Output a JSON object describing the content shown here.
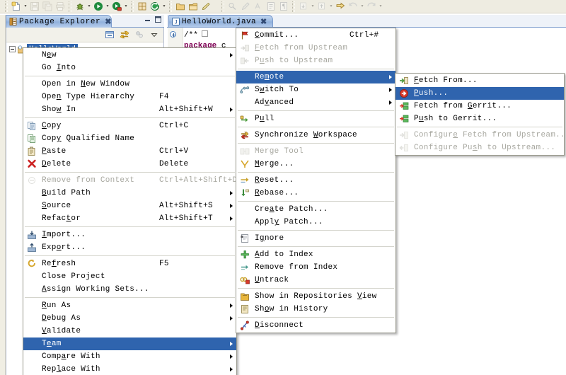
{
  "toolbar": {
    "groups": [
      {
        "name": "file-group",
        "buttons": [
          {
            "icon": "new-file-icon",
            "label": "New",
            "dropdown": true,
            "enabled": true
          },
          {
            "icon": "save-icon",
            "label": "Save",
            "dropdown": false,
            "enabled": false
          },
          {
            "icon": "save-all-icon",
            "label": "Save All",
            "dropdown": false,
            "enabled": false
          },
          {
            "icon": "print-icon",
            "label": "Print",
            "dropdown": false,
            "enabled": false
          }
        ]
      },
      {
        "name": "run-group",
        "buttons": [
          {
            "icon": "debug-icon",
            "label": "Debug",
            "dropdown": true,
            "enabled": true
          },
          {
            "icon": "run-icon",
            "label": "Run",
            "dropdown": true,
            "enabled": true
          },
          {
            "icon": "run-external-tools-icon",
            "label": "External Tools",
            "dropdown": true,
            "enabled": true
          }
        ]
      },
      {
        "name": "java-group",
        "buttons": [
          {
            "icon": "new-java-package-icon",
            "label": "New Java Package",
            "dropdown": false,
            "enabled": true
          },
          {
            "icon": "new-java-class-icon",
            "label": "New Java Class",
            "dropdown": true,
            "enabled": true
          }
        ]
      },
      {
        "name": "search-group",
        "buttons": [
          {
            "icon": "open-type-icon",
            "label": "Open Type",
            "dropdown": false,
            "enabled": true
          },
          {
            "icon": "open-task-icon",
            "label": "Open Task",
            "dropdown": false,
            "enabled": true
          },
          {
            "icon": "search-icon",
            "label": "Search",
            "dropdown": false,
            "enabled": true
          }
        ]
      },
      {
        "name": "nav-group",
        "buttons": [
          {
            "icon": "link-icon",
            "label": "Link",
            "dropdown": false,
            "enabled": false
          },
          {
            "icon": "pencil-icon",
            "label": "Edit",
            "dropdown": false,
            "enabled": false
          },
          {
            "icon": "spell-icon",
            "label": "Spell",
            "dropdown": false,
            "enabled": false
          },
          {
            "icon": "show-whitespace-icon",
            "label": "Show Whitespace",
            "dropdown": false,
            "enabled": false
          },
          {
            "icon": "pilcrow-icon",
            "label": "Paragraph Marks",
            "dropdown": false,
            "enabled": false
          }
        ]
      },
      {
        "name": "annotation-group",
        "buttons": [
          {
            "icon": "next-annotation-icon",
            "label": "Next Annotation",
            "dropdown": true,
            "enabled": false
          },
          {
            "icon": "prev-annotation-icon",
            "label": "Previous Annotation",
            "dropdown": true,
            "enabled": false
          },
          {
            "icon": "last-edit-location-icon",
            "label": "Last Edit Location",
            "dropdown": false,
            "enabled": true
          },
          {
            "icon": "back-icon",
            "label": "Back",
            "dropdown": true,
            "enabled": false
          },
          {
            "icon": "forward-icon",
            "label": "Forward",
            "dropdown": true,
            "enabled": false
          }
        ]
      }
    ]
  },
  "package_explorer": {
    "tab_label": "Package Explorer",
    "tab_icon": "package-explorer-icon",
    "close_icon": "close-icon",
    "minimize_label": "Minimize",
    "maximize_label": "Maximize",
    "toolbar_buttons": [
      {
        "icon": "collapse-all-icon",
        "label": "Collapse All"
      },
      {
        "icon": "link-with-editor-icon",
        "label": "Link with Editor"
      },
      {
        "icon": "view-menu-icon",
        "label": "View Menu"
      },
      {
        "icon": "chevron-down-icon",
        "label": "View Menu Chevron"
      }
    ],
    "selected_node": "HelloWorld"
  },
  "editor": {
    "tab_label": "HelloWorld.java",
    "tab_icon": "java-file-icon",
    "close_icon": "close-icon",
    "code_lines": [
      {
        "parts": [
          {
            "text": "/**",
            "style": "plain"
          }
        ]
      },
      {
        "parts": [
          {
            "text": "package",
            "style": "kw"
          },
          {
            "text": " c",
            "style": "plain"
          }
        ]
      }
    ]
  },
  "menu_context": {
    "name": "project-context-menu",
    "items": [
      {
        "label": "New",
        "mnemonic": "e",
        "accel": "",
        "submenu": true,
        "enabled": true,
        "icon": "",
        "selected": false
      },
      {
        "label": "Go Into",
        "mnemonic": "I",
        "accel": "",
        "submenu": false,
        "enabled": true,
        "icon": "",
        "selected": false
      },
      {
        "separator": true
      },
      {
        "label": "Open in New Window",
        "mnemonic": "N",
        "accel": "",
        "submenu": false,
        "enabled": true,
        "icon": "",
        "selected": false
      },
      {
        "label": "Open Type Hierarchy",
        "mnemonic": "n",
        "accel": "F4",
        "submenu": false,
        "enabled": true,
        "icon": "",
        "selected": false
      },
      {
        "label": "Show In",
        "mnemonic": "w",
        "accel": "Alt+Shift+W",
        "submenu": true,
        "enabled": true,
        "icon": "",
        "selected": false
      },
      {
        "separator": true
      },
      {
        "label": "Copy",
        "mnemonic": "C",
        "accel": "Ctrl+C",
        "submenu": false,
        "enabled": true,
        "icon": "copy-icon",
        "selected": false
      },
      {
        "label": "Copy Qualified Name",
        "mnemonic": "y",
        "accel": "",
        "submenu": false,
        "enabled": true,
        "icon": "copy-qualified-icon",
        "selected": false
      },
      {
        "label": "Paste",
        "mnemonic": "P",
        "accel": "Ctrl+V",
        "submenu": false,
        "enabled": true,
        "icon": "paste-icon",
        "selected": false
      },
      {
        "label": "Delete",
        "mnemonic": "D",
        "accel": "Delete",
        "submenu": false,
        "enabled": true,
        "icon": "delete-icon",
        "selected": false
      },
      {
        "separator": true
      },
      {
        "label": "Remove from Context",
        "mnemonic": "",
        "accel": "Ctrl+Alt+Shift+Down",
        "submenu": false,
        "enabled": false,
        "icon": "remove-context-icon",
        "selected": false
      },
      {
        "label": "Build Path",
        "mnemonic": "B",
        "accel": "",
        "submenu": true,
        "enabled": true,
        "icon": "",
        "selected": false
      },
      {
        "label": "Source",
        "mnemonic": "S",
        "accel": "Alt+Shift+S",
        "submenu": true,
        "enabled": true,
        "icon": "",
        "selected": false
      },
      {
        "label": "Refactor",
        "mnemonic": "t",
        "accel": "Alt+Shift+T",
        "submenu": true,
        "enabled": true,
        "icon": "",
        "selected": false
      },
      {
        "separator": true
      },
      {
        "label": "Import...",
        "mnemonic": "I",
        "accel": "",
        "submenu": false,
        "enabled": true,
        "icon": "import-icon",
        "selected": false
      },
      {
        "label": "Export...",
        "mnemonic": "o",
        "accel": "",
        "submenu": false,
        "enabled": true,
        "icon": "export-icon",
        "selected": false
      },
      {
        "separator": true
      },
      {
        "label": "Refresh",
        "mnemonic": "f",
        "accel": "F5",
        "submenu": false,
        "enabled": true,
        "icon": "refresh-icon",
        "selected": false
      },
      {
        "label": "Close Project",
        "mnemonic": "z",
        "accel": "",
        "submenu": false,
        "enabled": true,
        "icon": "",
        "selected": false
      },
      {
        "label": "Assign Working Sets...",
        "mnemonic": "A",
        "accel": "",
        "submenu": false,
        "enabled": true,
        "icon": "",
        "selected": false
      },
      {
        "separator": true
      },
      {
        "label": "Run As",
        "mnemonic": "R",
        "accel": "",
        "submenu": true,
        "enabled": true,
        "icon": "",
        "selected": false
      },
      {
        "label": "Debug As",
        "mnemonic": "D",
        "accel": "",
        "submenu": true,
        "enabled": true,
        "icon": "",
        "selected": false
      },
      {
        "label": "Validate",
        "mnemonic": "V",
        "accel": "",
        "submenu": false,
        "enabled": true,
        "icon": "",
        "selected": false
      },
      {
        "label": "Team",
        "mnemonic": "e",
        "accel": "",
        "submenu": true,
        "enabled": true,
        "icon": "",
        "selected": true
      },
      {
        "label": "Compare With",
        "mnemonic": "a",
        "accel": "",
        "submenu": true,
        "enabled": true,
        "icon": "",
        "selected": false
      },
      {
        "label": "Replace With",
        "mnemonic": "l",
        "accel": "",
        "submenu": true,
        "enabled": true,
        "icon": "",
        "selected": false
      }
    ]
  },
  "menu_team": {
    "name": "team-submenu",
    "items": [
      {
        "label": "Commit...",
        "mnemonic": "C",
        "accel": "Ctrl+#",
        "submenu": false,
        "enabled": true,
        "icon": "commit-icon",
        "selected": false
      },
      {
        "label": "Fetch from Upstream",
        "mnemonic": "F",
        "accel": "",
        "submenu": false,
        "enabled": false,
        "icon": "fetch-icon",
        "selected": false
      },
      {
        "label": "Push to Upstream",
        "mnemonic": "u",
        "accel": "",
        "submenu": false,
        "enabled": false,
        "icon": "push-icon",
        "selected": false
      },
      {
        "separator": true
      },
      {
        "label": "Remote",
        "mnemonic": "m",
        "accel": "",
        "submenu": true,
        "enabled": true,
        "icon": "",
        "selected": true
      },
      {
        "label": "Switch To",
        "mnemonic": "w",
        "accel": "",
        "submenu": true,
        "enabled": true,
        "icon": "switch-to-icon",
        "selected": false
      },
      {
        "label": "Advanced",
        "mnemonic": "v",
        "accel": "",
        "submenu": true,
        "enabled": true,
        "icon": "",
        "selected": false
      },
      {
        "separator": true
      },
      {
        "label": "Pull",
        "mnemonic": "u",
        "accel": "",
        "submenu": false,
        "enabled": true,
        "icon": "pull-icon",
        "selected": false
      },
      {
        "separator": true
      },
      {
        "label": "Synchronize Workspace",
        "mnemonic": "W",
        "accel": "",
        "submenu": false,
        "enabled": true,
        "icon": "synchronize-icon",
        "selected": false
      },
      {
        "separator": true
      },
      {
        "label": "Merge Tool",
        "mnemonic": "",
        "accel": "",
        "submenu": false,
        "enabled": false,
        "icon": "merge-tool-icon",
        "selected": false
      },
      {
        "label": "Merge...",
        "mnemonic": "M",
        "accel": "",
        "submenu": false,
        "enabled": true,
        "icon": "merge-icon",
        "selected": false
      },
      {
        "separator": true
      },
      {
        "label": "Reset...",
        "mnemonic": "R",
        "accel": "",
        "submenu": false,
        "enabled": true,
        "icon": "reset-icon",
        "selected": false
      },
      {
        "label": "Rebase...",
        "mnemonic": "R",
        "accel": "",
        "submenu": false,
        "enabled": true,
        "icon": "rebase-icon",
        "selected": false
      },
      {
        "separator": true
      },
      {
        "label": "Create Patch...",
        "mnemonic": "a",
        "accel": "",
        "submenu": false,
        "enabled": true,
        "icon": "",
        "selected": false
      },
      {
        "label": "Apply Patch...",
        "mnemonic": "y",
        "accel": "",
        "submenu": false,
        "enabled": true,
        "icon": "",
        "selected": false
      },
      {
        "separator": true
      },
      {
        "label": "Ignore",
        "mnemonic": "g",
        "accel": "",
        "submenu": false,
        "enabled": true,
        "icon": "ignore-icon",
        "selected": false
      },
      {
        "separator": true
      },
      {
        "label": "Add to Index",
        "mnemonic": "A",
        "accel": "",
        "submenu": false,
        "enabled": true,
        "icon": "add-to-index-icon",
        "selected": false
      },
      {
        "label": "Remove from Index",
        "mnemonic": "",
        "accel": "",
        "submenu": false,
        "enabled": true,
        "icon": "remove-from-index-icon",
        "selected": false
      },
      {
        "label": "Untrack",
        "mnemonic": "U",
        "accel": "",
        "submenu": false,
        "enabled": true,
        "icon": "untrack-icon",
        "selected": false
      },
      {
        "separator": true
      },
      {
        "label": "Show in Repositories View",
        "mnemonic": "V",
        "accel": "",
        "submenu": false,
        "enabled": true,
        "icon": "repositories-view-icon",
        "selected": false
      },
      {
        "label": "Show in History",
        "mnemonic": "o",
        "accel": "",
        "submenu": false,
        "enabled": true,
        "icon": "history-icon",
        "selected": false
      },
      {
        "separator": true
      },
      {
        "label": "Disconnect",
        "mnemonic": "D",
        "accel": "",
        "submenu": false,
        "enabled": true,
        "icon": "disconnect-icon",
        "selected": false
      }
    ]
  },
  "menu_remote": {
    "name": "remote-submenu",
    "items": [
      {
        "label": "Fetch From...",
        "mnemonic": "F",
        "accel": "",
        "submenu": false,
        "enabled": true,
        "icon": "fetch-from-icon",
        "selected": false
      },
      {
        "label": "Push...",
        "mnemonic": "P",
        "accel": "",
        "submenu": false,
        "enabled": true,
        "icon": "push-to-icon",
        "selected": true
      },
      {
        "label": "Fetch from Gerrit...",
        "mnemonic": "G",
        "accel": "",
        "submenu": false,
        "enabled": true,
        "icon": "fetch-gerrit-icon",
        "selected": false
      },
      {
        "label": "Push to Gerrit...",
        "mnemonic": "u",
        "accel": "",
        "submenu": false,
        "enabled": true,
        "icon": "push-gerrit-icon",
        "selected": false
      },
      {
        "separator": true
      },
      {
        "label": "Configure Fetch from Upstream...",
        "mnemonic": "e",
        "accel": "",
        "submenu": false,
        "enabled": false,
        "icon": "configure-fetch-icon",
        "selected": false
      },
      {
        "label": "Configure Push to Upstream...",
        "mnemonic": "s",
        "accel": "",
        "submenu": false,
        "enabled": false,
        "icon": "configure-push-icon",
        "selected": false
      }
    ]
  },
  "colors": {
    "selection_blue": "#2f64ae",
    "toolbar_bg": "#eeece1",
    "tab_blue": "#9cb9e0",
    "menu_bg": "#ffffff",
    "disabled_text": "#a8a8a0",
    "keyword_purple": "#7f0055"
  }
}
